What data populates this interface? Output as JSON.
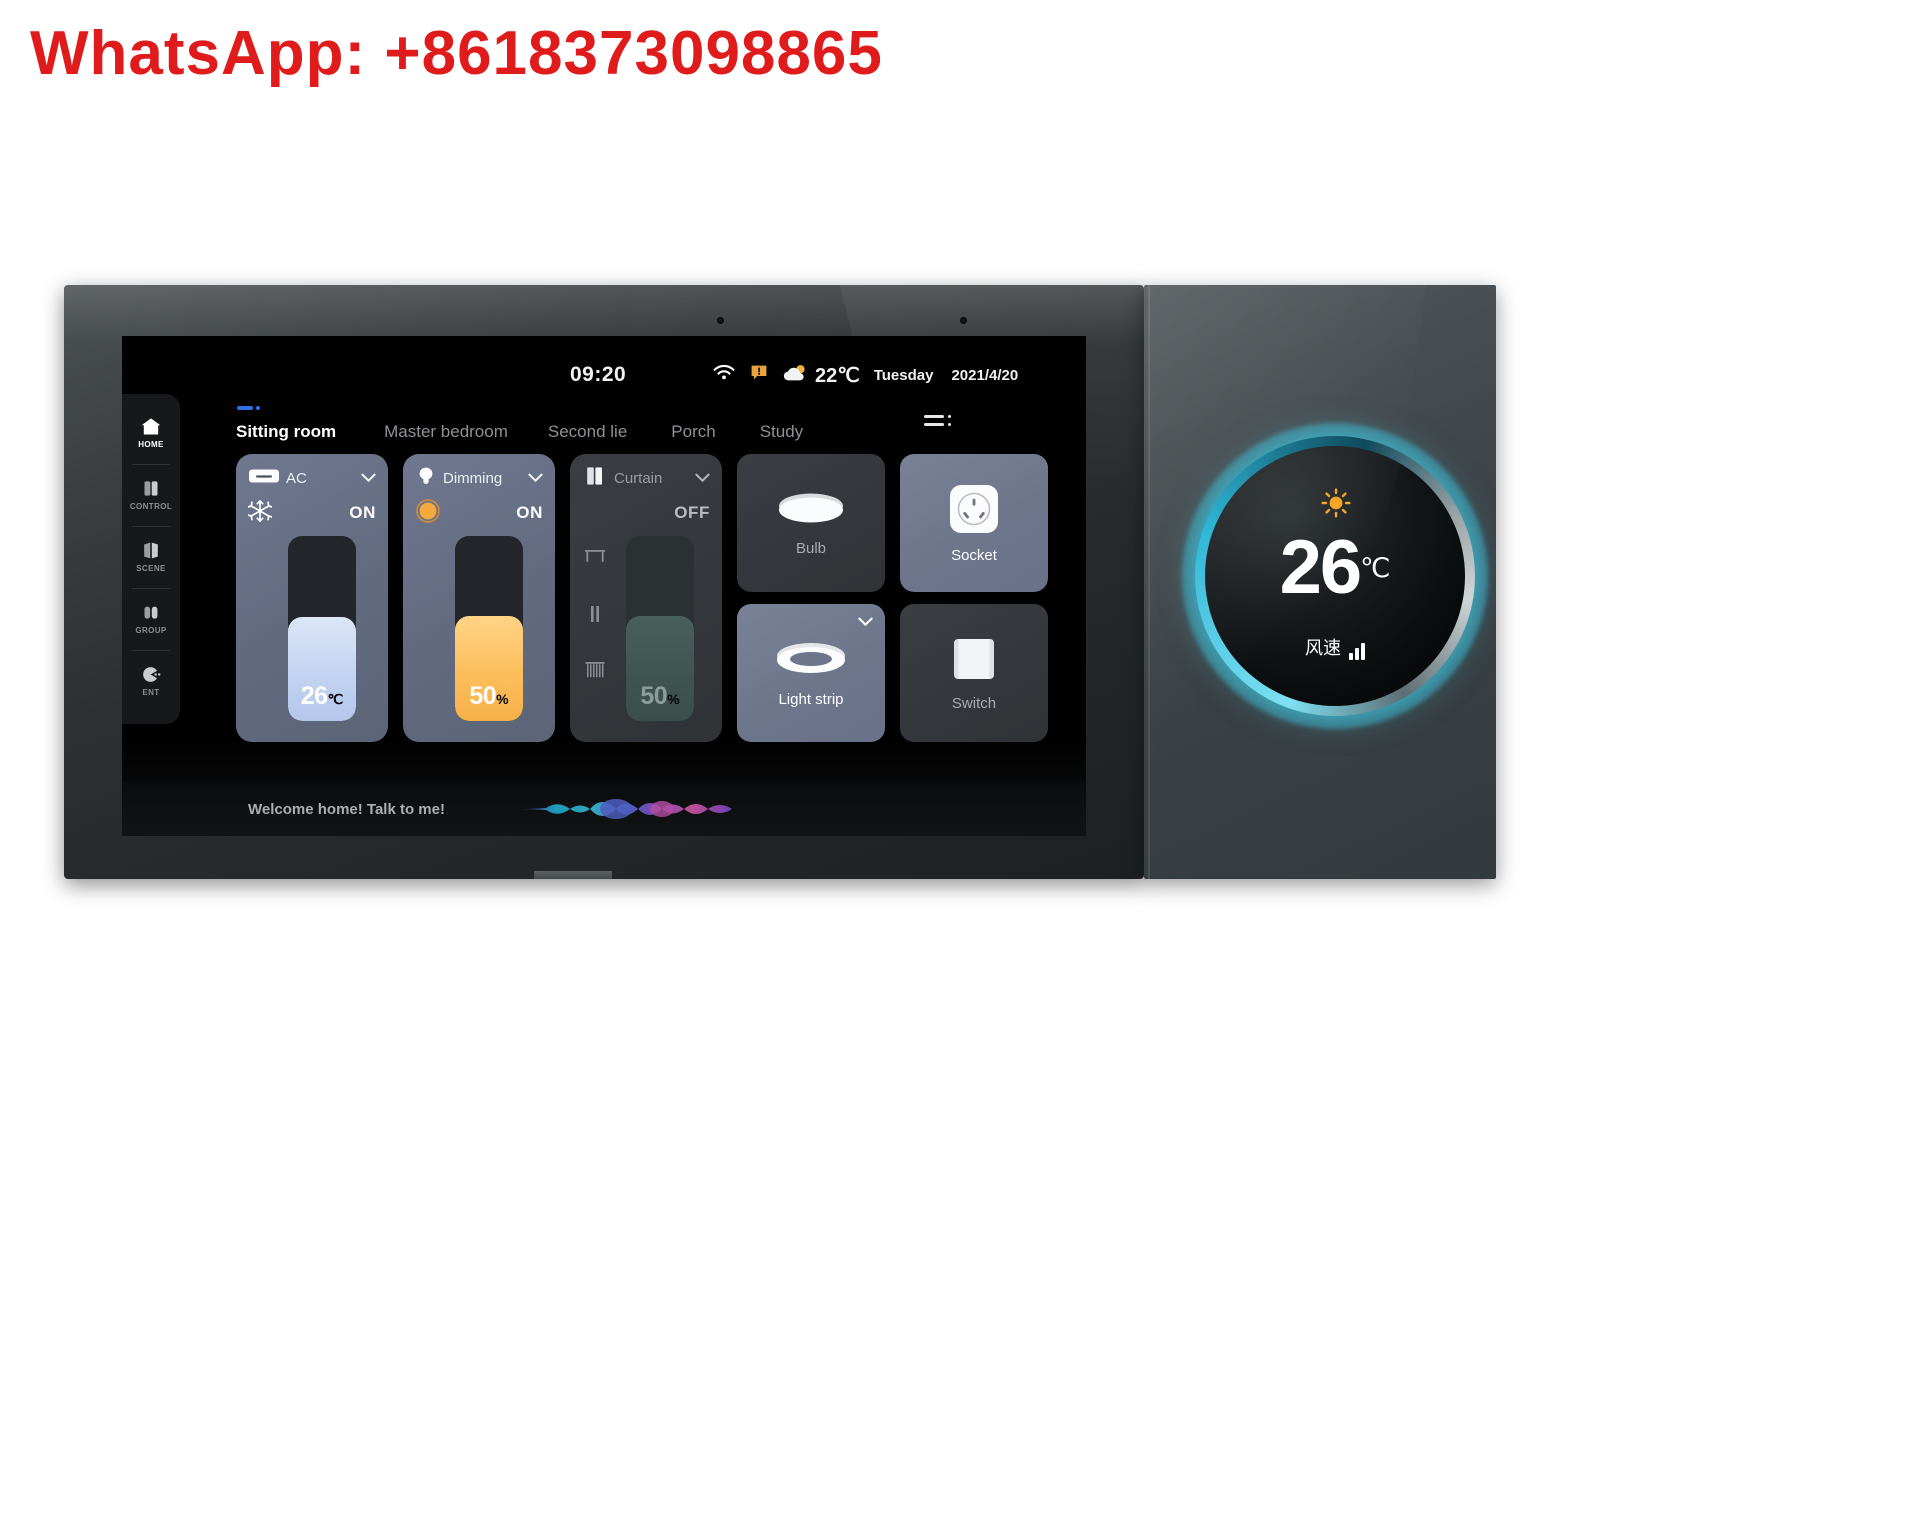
{
  "watermark": {
    "text": "WhatsApp: +8618373098865",
    "color": "#e01b1b"
  },
  "status_bar": {
    "time": "09:20",
    "wifi_icon": "wifi-icon",
    "alert_icon": "message-alert-icon",
    "weather_icon": "partly-cloudy-icon",
    "temperature": "22℃",
    "weekday": "Tuesday",
    "date": "2021/4/20"
  },
  "sidebar": {
    "items": [
      {
        "label": "HOME",
        "icon": "home-icon",
        "active": true
      },
      {
        "label": "CONTROL",
        "icon": "control-icon",
        "active": false
      },
      {
        "label": "SCENE",
        "icon": "scene-icon",
        "active": false
      },
      {
        "label": "GROUP",
        "icon": "group-icon",
        "active": false
      },
      {
        "label": "ENT",
        "icon": "entertainment-icon",
        "active": false
      }
    ]
  },
  "rooms": {
    "tabs": [
      {
        "label": "Sitting room",
        "active": true
      },
      {
        "label": "Master bedroom",
        "active": false
      },
      {
        "label": "Second lie",
        "active": false
      },
      {
        "label": "Porch",
        "active": false
      },
      {
        "label": "Study",
        "active": false
      }
    ],
    "menu_icon": "list-menu-icon"
  },
  "cards": {
    "ac": {
      "title": "AC",
      "icon": "air-conditioner-icon",
      "mode_icon": "snowflake-icon",
      "state": "ON",
      "value": "26",
      "unit": "℃",
      "fill_percent": 56,
      "chevron": "chevron-down-icon",
      "accent": "#c3d4f2"
    },
    "dimming": {
      "title": "Dimming",
      "icon": "bulb-icon",
      "mode_icon": "brightness-dot-icon",
      "state": "ON",
      "value": "50",
      "unit": "%",
      "fill_percent": 57,
      "chevron": "chevron-down-icon",
      "accent": "#f7b14a"
    },
    "curtain": {
      "title": "Curtain",
      "icon": "curtain-icon",
      "state": "OFF",
      "value": "50",
      "unit": "%",
      "fill_percent": 57,
      "chevron": "chevron-down-icon",
      "controls": [
        "curtain-open-icon",
        "curtain-pause-icon",
        "curtain-close-icon"
      ],
      "accent": "#3f5551"
    },
    "tiles": [
      {
        "label": "Bulb",
        "icon": "ceiling-lamp-icon",
        "on": false,
        "chevron": null
      },
      {
        "label": "Socket",
        "icon": "power-socket-icon",
        "on": true,
        "chevron": null
      },
      {
        "label": "Light strip",
        "icon": "ring-light-icon",
        "on": true,
        "chevron": "chevron-down-icon"
      },
      {
        "label": "Switch",
        "icon": "wall-switch-icon",
        "on": false,
        "chevron": null
      }
    ]
  },
  "voice_bar": {
    "text": "Welcome home! Talk to me!",
    "waveform_icon": "voice-waveform-icon"
  },
  "thermostat": {
    "mode_icon": "sun-icon",
    "temperature": "26",
    "unit": "℃",
    "fan_label": "风速",
    "fan_level_icon": "signal-bars-icon",
    "ring_color": "#3fcde9"
  }
}
